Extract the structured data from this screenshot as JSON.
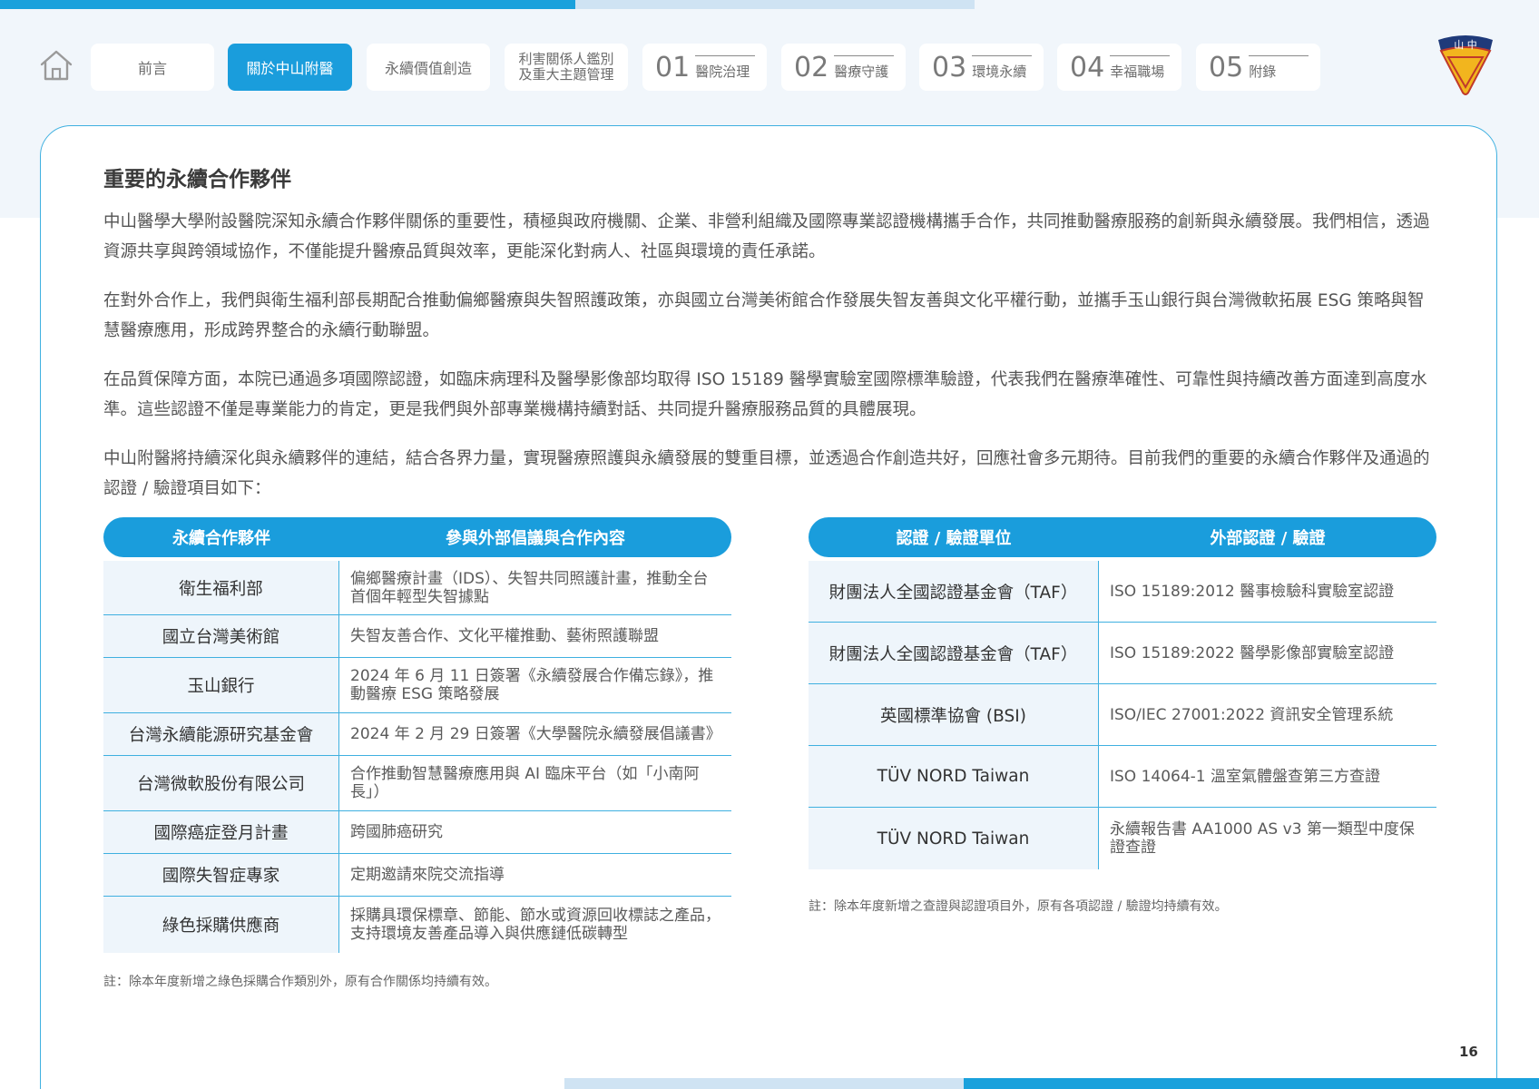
{
  "nav": {
    "tabs": [
      {
        "label": "前言"
      },
      {
        "label": "關於中山附醫",
        "active": true
      },
      {
        "label": "永續價值創造"
      },
      {
        "label": "利害關係人鑑別\n及重大主題管理"
      },
      {
        "num": "01",
        "label": "醫院治理"
      },
      {
        "num": "02",
        "label": "醫療守護"
      },
      {
        "num": "03",
        "label": "環境永續"
      },
      {
        "num": "04",
        "label": "幸福職場"
      },
      {
        "num": "05",
        "label": "附錄"
      }
    ]
  },
  "logo": {
    "text": "山 中"
  },
  "colors": {
    "accent": "#1a9ddc",
    "accent_light": "#cfe3f3",
    "row_bg": "#eef5fb"
  },
  "section": {
    "title": "重要的永續合作夥伴",
    "paragraphs": [
      "中山醫學大學附設醫院深知永續合作夥伴關係的重要性，積極與政府機關、企業、非營利組織及國際專業認證機構攜手合作，共同推動醫療服務的創新與永續發展。我們相信，透過資源共享與跨領域協作，不僅能提升醫療品質與效率，更能深化對病人、社區與環境的責任承諾。",
      "在對外合作上，我們與衛生福利部長期配合推動偏鄉醫療與失智照護政策，亦與國立台灣美術館合作發展失智友善與文化平權行動，並攜手玉山銀行與台灣微軟拓展 ESG 策略與智慧醫療應用，形成跨界整合的永續行動聯盟。",
      "在品質保障方面，本院已通過多項國際認證，如臨床病理科及醫學影像部均取得 ISO 15189 醫學實驗室國際標準驗證，代表我們在醫療準確性、可靠性與持續改善方面達到高度水準。這些認證不僅是專業能力的肯定，更是我們與外部專業機構持續對話、共同提升醫療服務品質的具體展現。",
      "中山附醫將持續深化與永續夥伴的連結，結合各界力量，實現醫療照護與永續發展的雙重目標，並透過合作創造共好，回應社會多元期待。目前我們的重要的永續合作夥伴及通過的認證 / 驗證項目如下："
    ]
  },
  "partners_table": {
    "headers": [
      "永續合作夥伴",
      "參與外部倡議與合作內容"
    ],
    "rows": [
      {
        "partner": "衛生福利部",
        "content": "偏鄉醫療計畫（IDS）、失智共同照護計畫，推動全台首個年輕型失智據點"
      },
      {
        "partner": "國立台灣美術館",
        "content": "失智友善合作、文化平權推動、藝術照護聯盟"
      },
      {
        "partner": "玉山銀行",
        "content": "2024 年 6 月 11 日簽署《永續發展合作備忘錄》，推動醫療 ESG 策略發展"
      },
      {
        "partner": "台灣永續能源研究基金會",
        "content": "2024 年 2 月 29 日簽署《大學醫院永續發展倡議書》"
      },
      {
        "partner": "台灣微軟股份有限公司",
        "content": "合作推動智慧醫療應用與 AI 臨床平台（如「小南阿長」）"
      },
      {
        "partner": "國際癌症登月計畫",
        "content": "跨國肺癌研究"
      },
      {
        "partner": "國際失智症專家",
        "content": "定期邀請來院交流指導"
      },
      {
        "partner": "綠色採購供應商",
        "content": "採購具環保標章、節能、節水或資源回收標誌之產品，支持環境友善產品導入與供應鏈低碳轉型"
      }
    ],
    "note": "註：除本年度新增之綠色採購合作類別外，原有合作關係均持續有效。"
  },
  "certs_table": {
    "headers": [
      "認證 / 驗證單位",
      "外部認證 / 驗證"
    ],
    "rows": [
      {
        "unit": "財團法人全國認證基金會（TAF）",
        "cert": "ISO 15189:2012 醫事檢驗科實驗室認證"
      },
      {
        "unit": "財團法人全國認證基金會（TAF）",
        "cert": "ISO 15189:2022 醫學影像部實驗室認證"
      },
      {
        "unit": "英國標準協會 (BSI)",
        "cert": "ISO/IEC 27001:2022 資訊安全管理系統"
      },
      {
        "unit": "TÜV NORD Taiwan",
        "cert": "ISO 14064-1 溫室氣體盤查第三方查證"
      },
      {
        "unit": "TÜV NORD Taiwan",
        "cert": "永續報告書 AA1000 AS v3 第一類型中度保證查證"
      }
    ],
    "note": "註：除本年度新增之查證與認證項目外，原有各項認證 / 驗證均持續有效。"
  },
  "page_number": "16"
}
